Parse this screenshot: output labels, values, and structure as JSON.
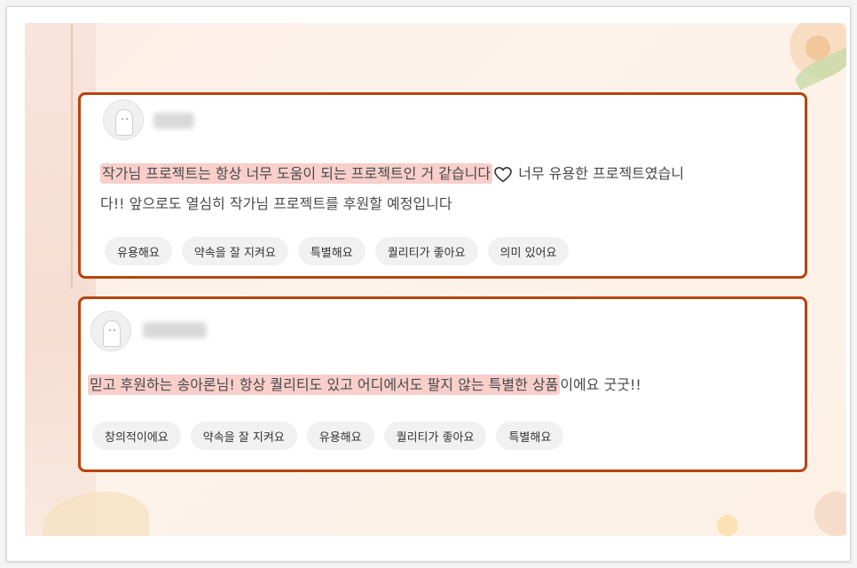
{
  "reviews": [
    {
      "username": "●●●",
      "highlight_text": "작가님 프로젝트는 항상 너무 도움이 되는 프로젝트인 거 같습니다",
      "heart_icon": "heart-icon",
      "line1_rest": " 너무 유용한 프로젝트였습니",
      "line2": "다!! 앞으로도 열심히 작가님 프로젝트를 후원할 예정입니다",
      "tags": [
        "유용해요",
        "약속을 잘 지켜요",
        "특별해요",
        "퀄리티가 좋아요",
        "의미 있어요"
      ]
    },
    {
      "username": "●●●●",
      "highlight_text": "믿고 후원하는 송아론님! 항상 퀄리티도 있고 어디에서도 팔지 않는 특별한 상품",
      "text_rest": "이에요 굿굿!!",
      "tags": [
        "창의적이에요",
        "약속을 잘 지켜요",
        "유용해요",
        "퀄리티가 좋아요",
        "특별해요"
      ]
    }
  ],
  "colors": {
    "card_border": "#b8440d",
    "highlight": "#f8cfcb",
    "tag_bg": "#f1f1f1"
  }
}
